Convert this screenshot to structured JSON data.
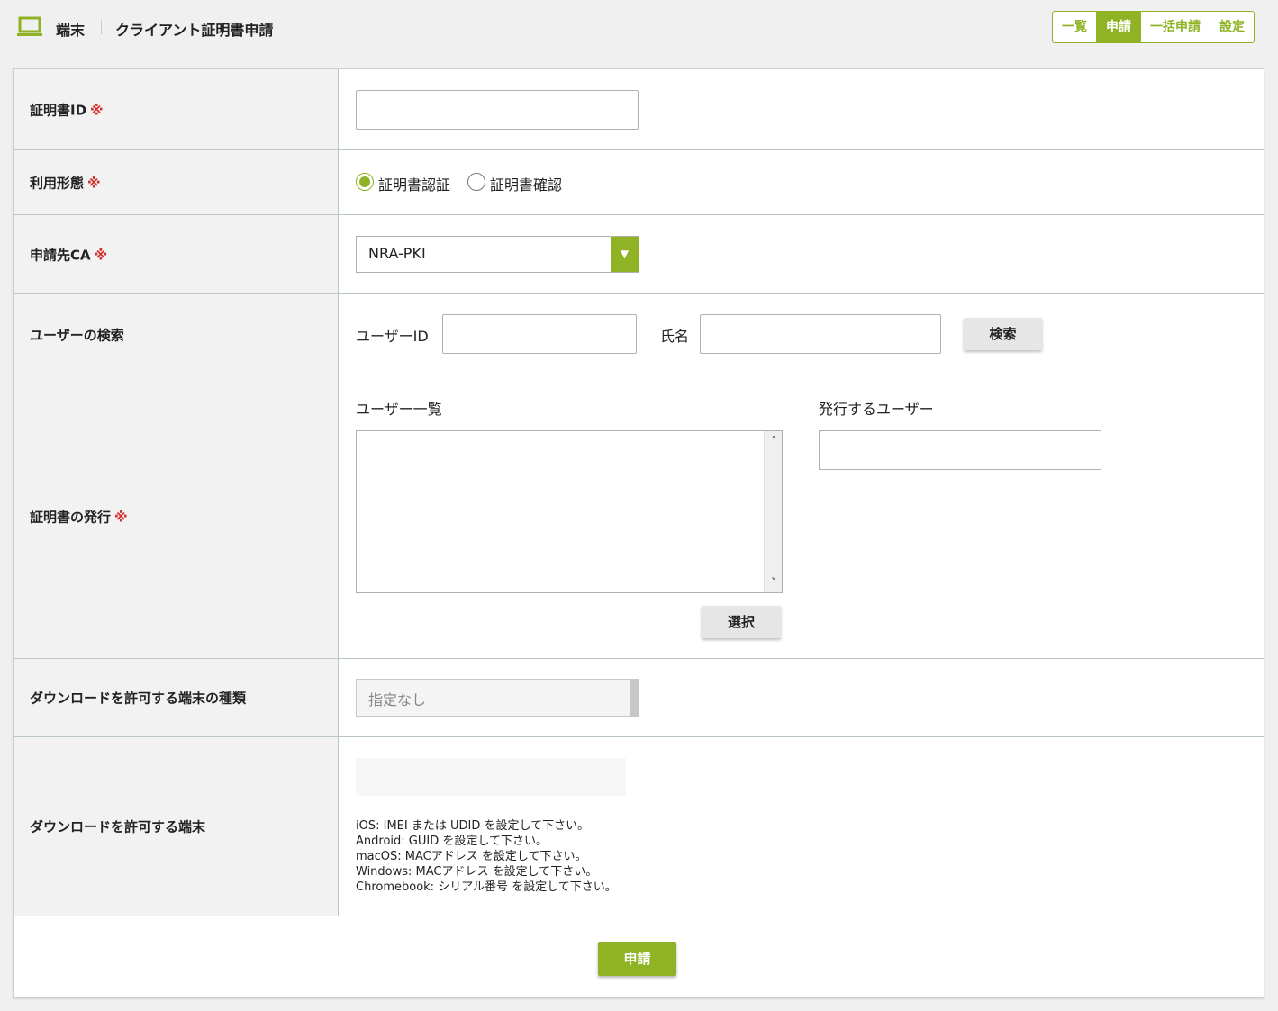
{
  "header": {
    "section": "端末",
    "title": "クライアント証明書申請",
    "tabs": [
      {
        "label": "一覧",
        "active": false
      },
      {
        "label": "申請",
        "active": true
      },
      {
        "label": "一括申請",
        "active": false
      },
      {
        "label": "設定",
        "active": false
      }
    ]
  },
  "colors": {
    "accent": "#8fb325",
    "required": "#d0312d"
  },
  "form": {
    "required_mark": "※",
    "cert_id": {
      "label": "証明書ID",
      "value": ""
    },
    "usage": {
      "label": "利用形態",
      "options": [
        {
          "label": "証明書認証",
          "checked": true
        },
        {
          "label": "証明書確認",
          "checked": false
        }
      ]
    },
    "ca": {
      "label": "申請先CA",
      "value": "NRA-PKI",
      "arrow": "▼"
    },
    "user_search": {
      "label": "ユーザーの検索",
      "user_id_label": "ユーザーID",
      "user_id_value": "",
      "name_label": "氏名",
      "name_value": "",
      "search_button": "検索"
    },
    "issue": {
      "label": "証明書の発行",
      "user_list_title": "ユーザー一覧",
      "issuing_user_title": "発行するユーザー",
      "select_button": "選択",
      "scroll_up": "˄",
      "scroll_down": "˅"
    },
    "device_type": {
      "label": "ダウンロードを許可する端末の種類",
      "value": "指定なし"
    },
    "device": {
      "label": "ダウンロードを許可する端末",
      "value": "",
      "help": [
        "iOS: IMEI または UDID を設定して下さい。",
        "Android: GUID を設定して下さい。",
        "macOS: MACアドレス を設定して下さい。",
        "Windows: MACアドレス を設定して下さい。",
        "Chromebook: シリアル番号 を設定して下さい。"
      ]
    },
    "submit_button": "申請"
  }
}
